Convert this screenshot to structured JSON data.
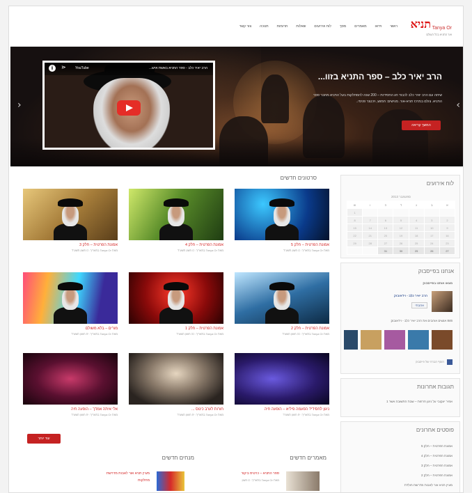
{
  "logo": {
    "mark": "תניא",
    "text": "Tanya Or",
    "sub": "אור התניא בכל העולם"
  },
  "nav": [
    "ראשי",
    "וידאו",
    "מאמרים",
    "מסך",
    "לוח אירועים",
    "שאלות",
    "תרומות",
    "תנוכה",
    "צור קשר"
  ],
  "hero": {
    "title": "הרב יאיר כלב – ספר התניא בזוו...",
    "description": "שיחה עם הרב יאיר כלב לכבוד חג החסידות – 200 שנה להסתלקות בעל התניא מחבר ספר התניא. צולם במרכז תניא-אור. מגישים: חמוש, ויכטנר פנימי..",
    "button": "המשך קריאה",
    "video_title": "הרב יאיר כלב - ספר התניא באשת איש...",
    "youtube": "YouTube"
  },
  "videos_title": "סרטונים חדשים",
  "videos": [
    {
      "title": "אמונת הפרטית – חלק 5",
      "meta": "מאת Tanya Or בתאריך: כו חשון תשע\"ד"
    },
    {
      "title": "אמונת הפרטית – חלק 4",
      "meta": "מאת Tanya Or בתאריך: כו חשון תשע\"ד"
    },
    {
      "title": "אמונת הפרטית – חלק 3",
      "meta": "מאת Tanya Or בתאריך: כו חשון תשע\"ד"
    },
    {
      "title": "אמונת הפרטית – חלק 2",
      "meta": "מאת Tanya Or בתאריך: כה חשון תשע\"ד"
    },
    {
      "title": "אמונת הפרטית – חלק 1",
      "meta": "מאת Tanya Or בתאריך: כה חשון תשע\"ד"
    },
    {
      "title": "מורים – בלא משולם",
      "meta": "מאת Tanya Or בתאריך: יח חשון תשע\"ד"
    },
    {
      "title": "ניגון לחסידי? הפעמה פיליא – הופעה חיה",
      "meta": "מאת Tanya Or בתאריך: יח חשון תשע\"ד"
    },
    {
      "title": "חורות לערב כינוס ...",
      "meta": "מאת Tanya Or בתאריך: יח חשון תשע\"ד"
    },
    {
      "title": "אלי איתה אמדך – הופעה חיה",
      "meta": "מאת Tanya Or בתאריך: יח חשון תשע\"ד"
    }
  ],
  "more_button": "עוד יותר",
  "articles_title": "מאמרים חדשים",
  "article": {
    "title": "ספר התניא – כרטיס ביקור",
    "meta": "מאת Tanya Or בתאריך: כו חשון"
  },
  "mentors_title": "מנחים חדשים",
  "mentor": {
    "title": "מעיין תניא אור לאבות מדרשת",
    "meta": "מחלקות"
  },
  "sidebar": {
    "calendar_title": "לוח אירועים",
    "calendar_caption": "ספטמבר 2013",
    "weekdays": [
      "א",
      "ב",
      "ג",
      "ד",
      "ה",
      "ו",
      "ש"
    ],
    "days": [
      [
        "",
        "",
        "",
        "",
        "",
        "",
        "1"
      ],
      [
        "2",
        "3",
        "4",
        "5",
        "6",
        "7",
        "8"
      ],
      [
        "9",
        "10",
        "11",
        "12",
        "13",
        "14",
        "15"
      ],
      [
        "16",
        "17",
        "18",
        "19",
        "20",
        "21",
        "22"
      ],
      [
        "23",
        "24",
        "25",
        "26",
        "27",
        "28",
        "29"
      ],
      [
        "30",
        "31",
        "",
        "",
        "",
        "",
        ""
      ]
    ],
    "calendar_bottom": [
      "27",
      "26",
      "25",
      "30",
      "31"
    ],
    "facebook_title": "אנחנו בפייסבוק",
    "facebook_sub": "מצאו אותנו בפייסבוק",
    "fb_page_name": "הרב יאיר כלב - וידאו‏בוק",
    "fb_like": "אהבתי",
    "fb_count": "846 אנשים אוהבים את הרב יאיר כלב - וידאובוק",
    "fb_plugin": "תוסף חברתי של פייסבוק",
    "comments_title": "תגובות אחרונות",
    "comment": "אמיר יעקובי על ניגון חרוזות – שבת התשובה אשר 1",
    "posts_title": "פוסטים אחרונים",
    "posts": [
      "אמונת הפרטית – חלק 5",
      "אמונת הפרטית – חלק 4",
      "אמונת הפרטית – חלק 3",
      "אמונת הפרטית – חלק 2",
      "מעיין תניא אור לאבות מדרשת חולדת"
    ]
  }
}
